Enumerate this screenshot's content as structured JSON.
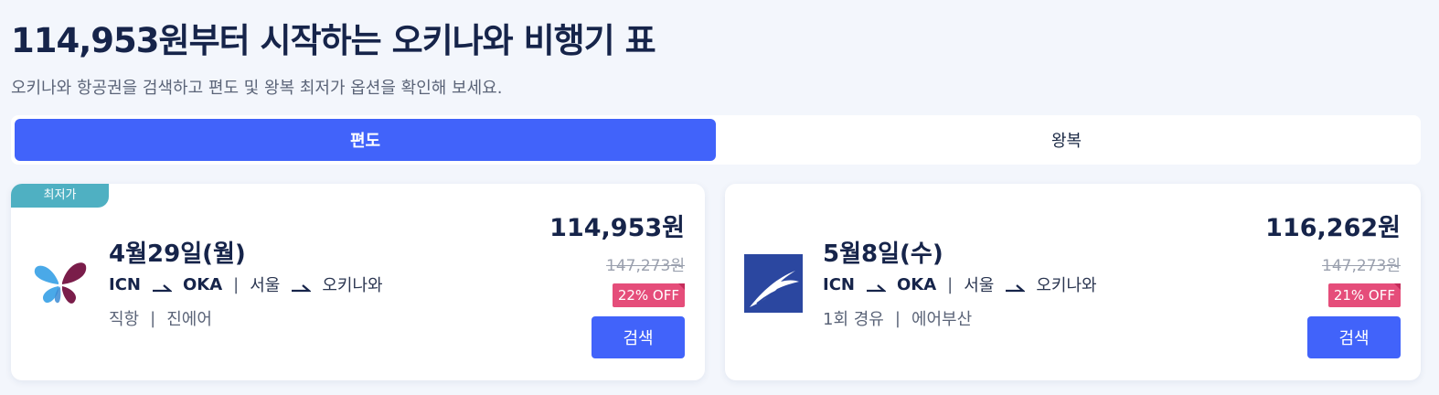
{
  "header": {
    "title": "114,953원부터 시작하는 오키나와 비행기 표",
    "subtitle": "오키나와 항공권을 검색하고 편도 및 왕복 최저가 옵션을 확인해 보세요."
  },
  "trip_toggle": {
    "options": [
      {
        "label": "편도",
        "active": true
      },
      {
        "label": "왕복",
        "active": false
      }
    ]
  },
  "flights": [
    {
      "badge": "최저가",
      "airline_logo": "jinair-butterfly-logo",
      "date": "4월29일(월)",
      "origin_code": "ICN",
      "dest_code": "OKA",
      "origin_city": "서울",
      "dest_city": "오키나와",
      "stops": "직항",
      "airline": "진에어",
      "price": "114,953원",
      "original_price": "147,273원",
      "discount": "22% OFF",
      "search_label": "검색"
    },
    {
      "badge": "",
      "airline_logo": "airbusan-bird-logo",
      "date": "5월8일(수)",
      "origin_code": "ICN",
      "dest_code": "OKA",
      "origin_city": "서울",
      "dest_city": "오키나와",
      "stops": "1회 경유",
      "airline": "에어부산",
      "price": "116,262원",
      "original_price": "147,273원",
      "discount": "21% OFF",
      "search_label": "검색"
    }
  ],
  "colors": {
    "primary": "#4163fa",
    "badge": "#4fb0c2",
    "discount": "#e54d7a",
    "text_dark": "#16244a",
    "background": "#f3f6fc"
  }
}
